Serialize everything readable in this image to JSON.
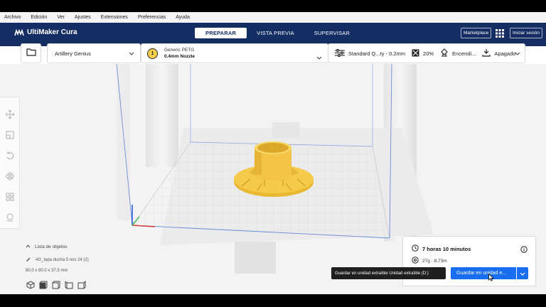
{
  "menu": [
    "Archivo",
    "Edición",
    "Ver",
    "Ajustes",
    "Extensiones",
    "Preferencias",
    "Ayuda"
  ],
  "header": {
    "app_name": "UltiMaker Cura",
    "tabs": [
      {
        "label": "PREPARAR",
        "active": true
      },
      {
        "label": "VISTA PREVIA",
        "active": false
      },
      {
        "label": "SUPERVISAR",
        "active": false
      }
    ],
    "marketplace_label": "Marketplace",
    "signin_label": "Iniciar sesión"
  },
  "toolbar": {
    "printer": "Artillery Genius",
    "extruder_number": "1",
    "material": "Generic PETG",
    "nozzle": "0.4mm Nozzle",
    "profile": "Standard Q...ty - 0.2mm",
    "infill": "20%",
    "support": "Encendi...",
    "adhesion": "Apagado"
  },
  "object_list": {
    "header": "Lista de objetos",
    "item": "4G_tapa ducha 5 nos 24 (2)",
    "dimensions": "80.0 x 80.0 x 37.5 mm"
  },
  "print_panel": {
    "time": "7 horas 10 minutos",
    "material_usage": "27g · 8.73m",
    "save_label": "Guardar en unidad e...",
    "tooltip": "Guardar en unidad extraíble Unidad extraíble (D:)"
  },
  "colors": {
    "header_bg": "#142d63",
    "accent_blue": "#196ef0",
    "model_yellow": "#f5c94a",
    "extruder_badge": "#f5d04a"
  },
  "icons": {
    "open": "folder-icon",
    "settings": "sliders-icon",
    "infill": "infill-icon",
    "support": "support-icon",
    "adhesion": "adhesion-icon",
    "apps": "grid-apps-icon",
    "time": "clock-icon",
    "material": "spool-icon",
    "info": "info-icon"
  }
}
